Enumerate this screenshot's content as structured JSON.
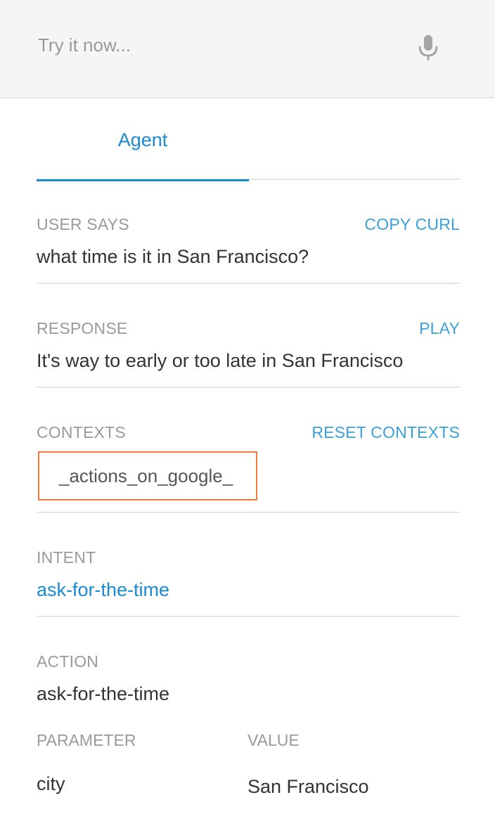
{
  "search": {
    "placeholder": "Try it now...",
    "mic_icon": "microphone-icon"
  },
  "tabs": [
    {
      "label": "Agent",
      "active": true
    }
  ],
  "user_says": {
    "label": "USER SAYS",
    "action": "COPY CURL",
    "value": "what time is it in San Francisco?"
  },
  "response": {
    "label": "RESPONSE",
    "action": "PLAY",
    "value": "It's way to early or too late in San Francisco"
  },
  "contexts": {
    "label": "CONTEXTS",
    "action": "RESET CONTEXTS",
    "items": [
      "_actions_on_google_"
    ]
  },
  "intent": {
    "label": "INTENT",
    "value": "ask-for-the-time"
  },
  "action": {
    "label": "ACTION",
    "value": "ask-for-the-time"
  },
  "parameters": {
    "col_parameter": "PARAMETER",
    "col_value": "VALUE",
    "rows": [
      {
        "parameter": "city",
        "value": "San Francisco"
      }
    ]
  },
  "colors": {
    "accent": "#1a8ad1",
    "link": "#3aa0dc",
    "highlight_border": "#ef7a3c",
    "label_gray": "#9a9a9a",
    "text": "#333333"
  }
}
